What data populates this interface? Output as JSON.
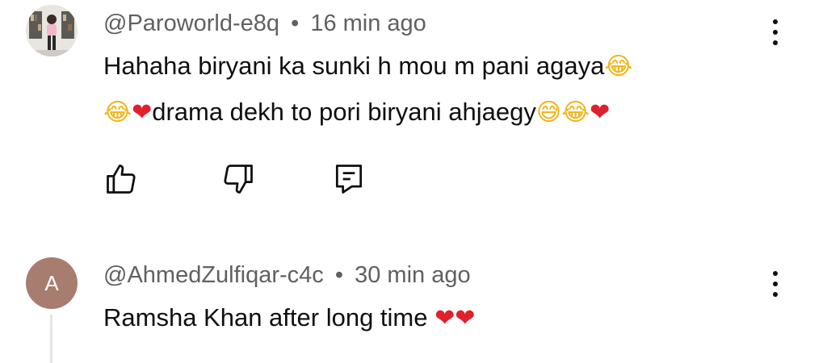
{
  "comments": [
    {
      "handle": "@Paroworld-e8q",
      "separator": "•",
      "time": "16 min ago",
      "line1": "Hahaha biryani ka sunki h mou m pani agaya",
      "line2": "drama dekh to pori biryani ahjaegy"
    },
    {
      "avatar_letter": "A",
      "handle": "@AhmedZulfiqar-c4c",
      "separator": "•",
      "time": "30 min ago",
      "text": "Ramsha Khan after long time"
    }
  ],
  "emoji": {
    "laugh": "😂",
    "heart": "❤",
    "sweat_smile": "😅"
  },
  "colors": {
    "meta": "#606060",
    "text": "#0f0f0f",
    "avatar_a": "#a77d70",
    "heart": "#e0202b"
  },
  "icons": [
    "thumbs-up-icon",
    "thumbs-down-icon",
    "reply-icon",
    "more-vert-icon"
  ]
}
